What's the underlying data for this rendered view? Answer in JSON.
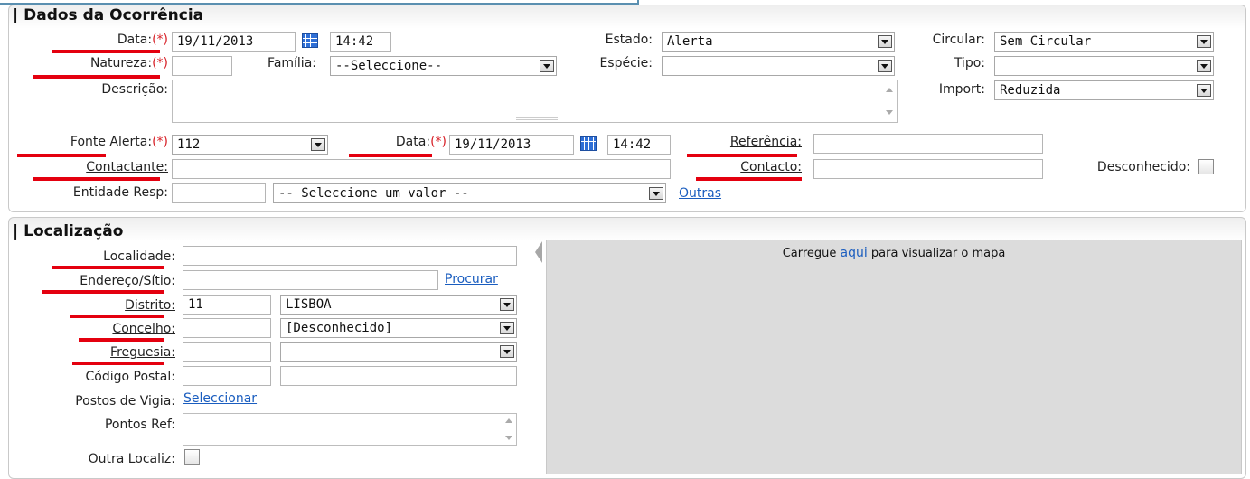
{
  "ocorrencia": {
    "title": "| Dados da Ocorrência",
    "data_label": "Data:",
    "req": "(*)",
    "data_value": "19/11/2013",
    "hora_value": "14:42",
    "estado_label": "Estado:",
    "estado_value": "Alerta",
    "circular_label": "Circular:",
    "circular_value": "Sem Circular",
    "natureza_label": "Natureza:",
    "natureza_value": "",
    "familia_label": "Família:",
    "familia_value": "--Seleccione--",
    "especie_label": "Espécie:",
    "especie_value": "",
    "tipo_label": "Tipo:",
    "tipo_value": "",
    "descricao_label": "Descrição:",
    "import_label": "Import:",
    "import_value": "Reduzida",
    "fonte_label": "Fonte Alerta:",
    "fonte_value": "112",
    "data2_label": "Data:",
    "data2_value": "19/11/2013",
    "hora2_value": "14:42",
    "referencia_label": "Referência:",
    "referencia_value": "",
    "contactante_label": "Contactante:",
    "contactante_value": "",
    "contacto_label": "Contacto:",
    "contacto_value": "",
    "desconhecido_label": "Desconhecido:",
    "entidade_label": "Entidade Resp:",
    "entidade_value": "",
    "entidade_select": "-- Seleccione um valor --",
    "outras_link": "Outras"
  },
  "localizacao": {
    "title": "| Localização",
    "localidade_label": "Localidade:",
    "endereco_label": "Endereço/Sítio:",
    "procurar_link": "Procurar",
    "distrito_label": "Distrito:",
    "distrito_code": "11",
    "distrito_value": "LISBOA",
    "concelho_label": "Concelho:",
    "concelho_value": "[Desconhecido]",
    "freguesia_label": "Freguesia:",
    "freguesia_value": "",
    "codigo_label": "Código Postal:",
    "postos_label": "Postos de Vigia:",
    "seleccionar_link": "Seleccionar",
    "pontos_label": "Pontos Ref:",
    "outra_label": "Outra Localiz:",
    "map_prefix": "Carregue",
    "map_link": "aqui",
    "map_suffix": "para visualizar o mapa"
  },
  "colors": {
    "required": "#d8232a",
    "annotation": "#e4000f",
    "link": "#1a5dbf",
    "map_bg": "#dcdcdc"
  }
}
